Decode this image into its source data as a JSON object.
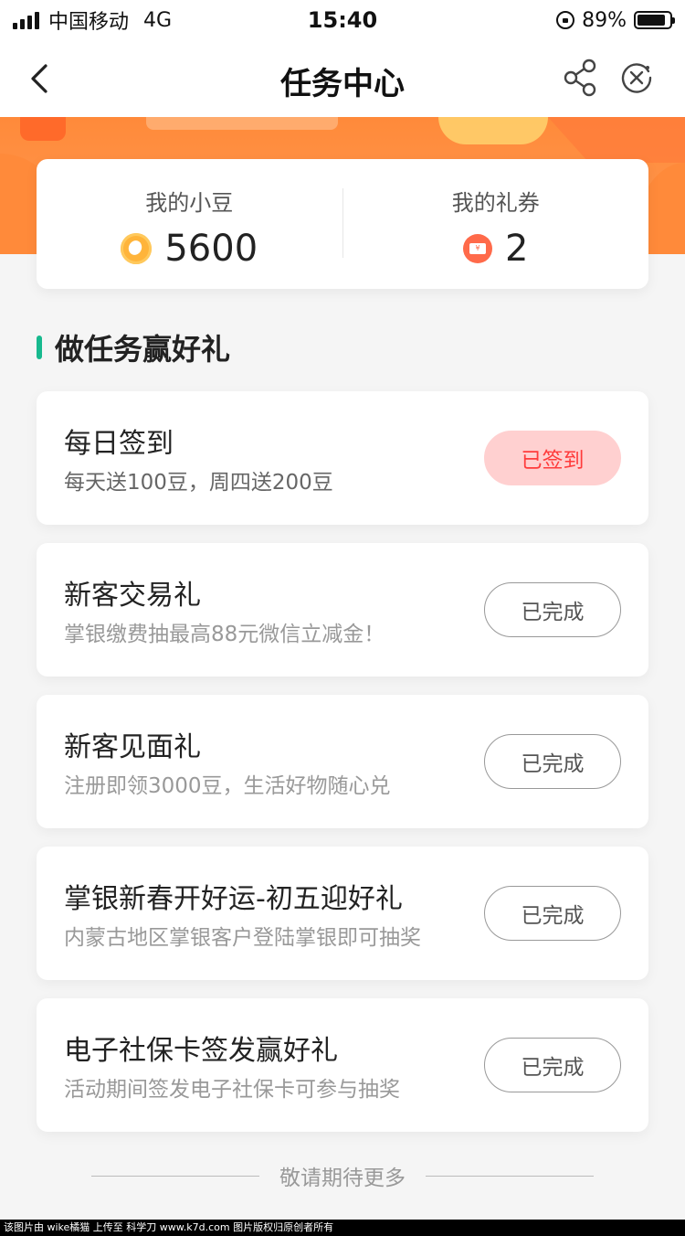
{
  "status_bar": {
    "carrier": "中国移动",
    "network": "4G",
    "time": "15:40",
    "battery_percent": "89%",
    "battery_level": 0.89
  },
  "nav": {
    "title": "任务中心",
    "back_icon": "chevron-left-icon",
    "share_icon": "share-icon",
    "close_icon": "close-circle-icon"
  },
  "assets": {
    "beans_label": "我的小豆",
    "beans_value": "5600",
    "coupons_label": "我的礼券",
    "coupons_value": "2",
    "beans_icon": "coin-icon",
    "coupons_icon": "ticket-icon"
  },
  "section": {
    "title": "做任务赢好礼",
    "accent_color": "#17b98e"
  },
  "tasks": [
    {
      "title": "每日签到",
      "desc": "每天送100豆，周四送200豆",
      "button": "已签到",
      "state": "signed"
    },
    {
      "title": "新客交易礼",
      "desc": "掌银缴费抽最高88元微信立减金！",
      "button": "已完成",
      "state": "done"
    },
    {
      "title": "新客见面礼",
      "desc": "注册即领3000豆，生活好物随心兑",
      "button": "已完成",
      "state": "done"
    },
    {
      "title": "掌银新春开好运-初五迎好礼",
      "desc": "内蒙古地区掌银客户登陆掌银即可抽奖",
      "button": "已完成",
      "state": "done"
    },
    {
      "title": "电子社保卡签发赢好礼",
      "desc": "活动期间签发电子社保卡可参与抽奖",
      "button": "已完成",
      "state": "done"
    }
  ],
  "footer": {
    "more_text": "敬请期待更多",
    "watermark": "该图片由 wike橘猫 上传至 科学刀 www.k7d.com 图片版权归原创者所有"
  },
  "colors": {
    "banner": "#ff8a3a",
    "signed_bg": "#ffd0d0",
    "signed_text": "#ff3b3b"
  }
}
